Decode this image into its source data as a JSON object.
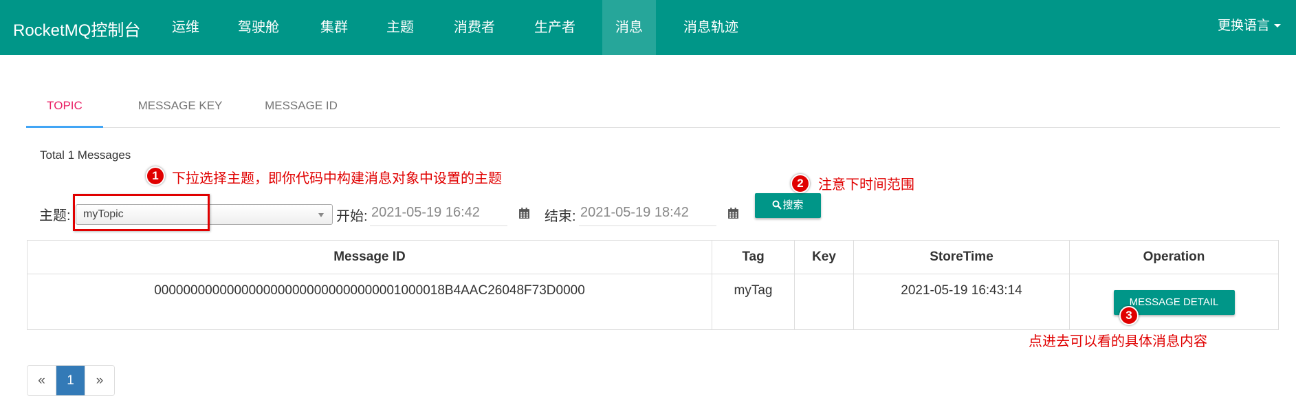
{
  "nav": {
    "brand": "RocketMQ控制台",
    "items": [
      {
        "label": "运维"
      },
      {
        "label": "驾驶舱"
      },
      {
        "label": "集群"
      },
      {
        "label": "主题"
      },
      {
        "label": "消费者"
      },
      {
        "label": "生产者"
      },
      {
        "label": "消息"
      },
      {
        "label": "消息轨迹"
      }
    ],
    "active_item": "消息",
    "language_label": "更换语言"
  },
  "tabs": [
    {
      "label": "TOPIC",
      "active": true
    },
    {
      "label": "MESSAGE KEY",
      "active": false
    },
    {
      "label": "MESSAGE ID",
      "active": false
    }
  ],
  "summary": {
    "total_text": "Total 1 Messages"
  },
  "filter": {
    "topic_label": "主题:",
    "topic_value": "myTopic",
    "start_label": "开始:",
    "start_value": "2021-05-19 16:42",
    "end_label": "结束:",
    "end_value": "2021-05-19 18:42",
    "search_label": "搜索"
  },
  "table": {
    "columns": [
      "Message ID",
      "Tag",
      "Key",
      "StoreTime",
      "Operation"
    ],
    "rows": [
      {
        "message_id": "0000000000000000000000000000000001000018B4AAC26048F73D0000",
        "tag": "myTag",
        "key": "",
        "store_time": "2021-05-19 16:43:14",
        "operation_label": "MESSAGE DETAIL"
      }
    ]
  },
  "pagination": {
    "prev": "«",
    "current": "1",
    "next": "»"
  },
  "annotations": [
    {
      "num": "1",
      "text": "下拉选择主题，即你代码中构建消息对象中设置的主题"
    },
    {
      "num": "2",
      "text": "注意下时间范围"
    },
    {
      "num": "3",
      "text": "点进去可以看的具体消息内容"
    }
  ],
  "colors": {
    "primary": "#009688",
    "tab_active": "#e91e63",
    "annotation": "#e00000",
    "page_active": "#337ab7"
  }
}
